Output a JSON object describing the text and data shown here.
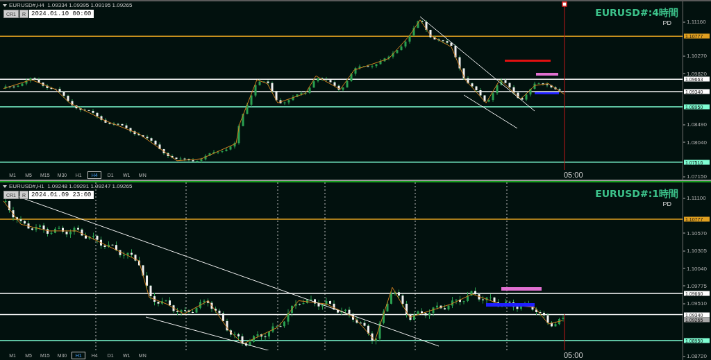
{
  "panels": [
    {
      "active": false,
      "header": "EURUSD#,H4  1.09334 1.09395 1.09195 1.09265",
      "buttons": [
        "CR1",
        "R"
      ],
      "date_field": "2024.01.10 00:00",
      "title": "EURUSD#:4時間",
      "subtitle": "PD",
      "time_label": "05:00",
      "ticks": [
        "1.11160",
        "1.10270",
        "1.09820",
        "1.08490",
        "1.08040",
        "1.07150"
      ],
      "levels": [
        {
          "price": "1.10777",
          "color": "#e0a020",
          "line": true
        },
        {
          "price": "1.09663",
          "color": "#ffffff",
          "line": true
        },
        {
          "price": "1.09340",
          "color": "#ffffff",
          "line": true
        },
        {
          "price": "1.08950",
          "color": "#7fffd4",
          "line": true
        },
        {
          "price": "1.07516",
          "color": "#7fffd4",
          "line": true
        }
      ],
      "timeframes": [
        {
          "label": "M1",
          "selected": false
        },
        {
          "label": "M5",
          "selected": false
        },
        {
          "label": "M15",
          "selected": false
        },
        {
          "label": "M30",
          "selected": false
        },
        {
          "label": "H1",
          "selected": false
        },
        {
          "label": "H4",
          "selected": true
        },
        {
          "label": "D1",
          "selected": false
        },
        {
          "label": "W1",
          "selected": false
        },
        {
          "label": "MN",
          "selected": false
        }
      ]
    },
    {
      "active": true,
      "header": "EURUSD#,H1  1.09248 1.09291 1.09247 1.09265",
      "buttons": [
        "CR1",
        "R"
      ],
      "date_field": "2024.01.09 23:00",
      "title": "EURUSD#:1時間",
      "subtitle": "PD",
      "time_label": "05:00",
      "ticks": [
        "1.11100",
        "1.10570",
        "1.10305",
        "1.10040",
        "1.09775",
        "1.09510",
        "1.08720"
      ],
      "levels": [
        {
          "price": "1.10777",
          "color": "#e0a020",
          "line": true
        },
        {
          "price": "1.09660",
          "color": "#ffffff",
          "line": true
        },
        {
          "price": "1.09340",
          "color": "#ffffff",
          "line": true
        },
        {
          "price": "1.09265",
          "color": "#a8a8a8",
          "line": false
        },
        {
          "price": "1.08950",
          "color": "#7fffd4",
          "line": true
        }
      ],
      "timeframes": [
        {
          "label": "M1",
          "selected": false
        },
        {
          "label": "M5",
          "selected": false
        },
        {
          "label": "M15",
          "selected": false
        },
        {
          "label": "M30",
          "selected": false
        },
        {
          "label": "H1",
          "selected": true
        },
        {
          "label": "H4",
          "selected": false
        },
        {
          "label": "D1",
          "selected": false
        },
        {
          "label": "W1",
          "selected": false
        },
        {
          "label": "MN",
          "selected": false
        }
      ]
    }
  ]
}
